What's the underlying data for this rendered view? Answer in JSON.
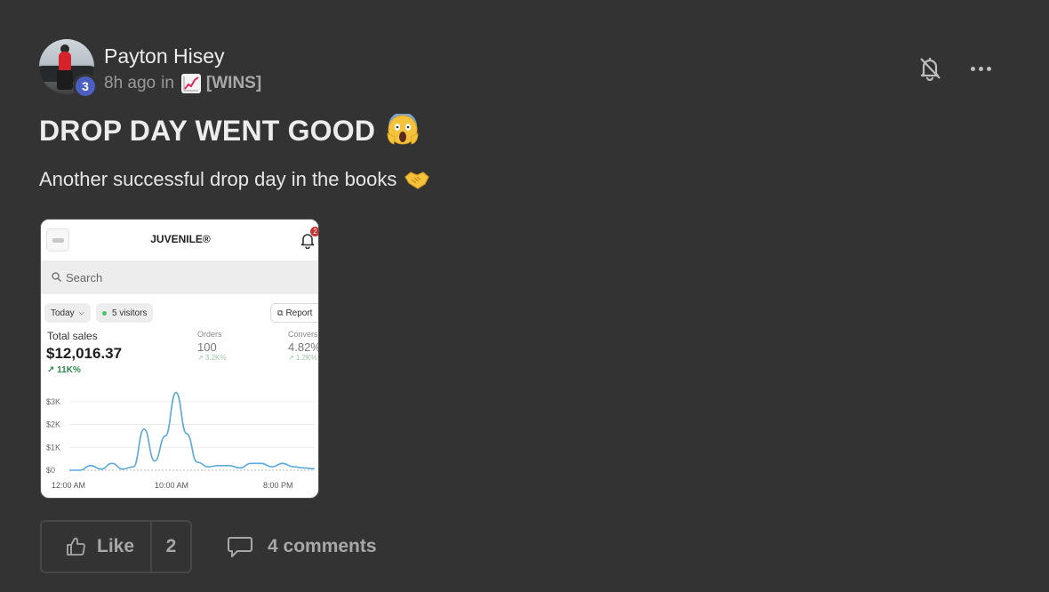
{
  "post": {
    "author": {
      "name": "Payton Hisey",
      "level": "3",
      "avatar_icon": "user-avatar"
    },
    "meta": {
      "time_ago": "8h ago",
      "in_label": "in",
      "category_icon": "chart-increasing-emoji",
      "category": "[WINS]"
    },
    "title": "DROP DAY WENT GOOD",
    "title_emoji": "face-screaming-in-fear-emoji",
    "body": "Another successful drop day in the books",
    "body_emoji": "handshake-emoji",
    "actions": {
      "like_label": "Like",
      "like_count": "2",
      "comments_label": "4 comments",
      "bell_icon": "bell-off-icon",
      "more_icon": "more-horizontal-icon"
    },
    "colors": {
      "background": "#333333",
      "level_badge": "#4a5fc1",
      "muted_text": "#9a9a9a"
    }
  },
  "attachment": {
    "store_name": "JUVENILE®",
    "notification_count": "2",
    "search_placeholder": "Search",
    "filter_today": "Today",
    "visitors": "5 visitors",
    "report_label": "Report",
    "total_sales_label": "Total sales",
    "total_sales_value": "$12,016.37",
    "total_sales_delta": "↗ 11K%",
    "orders_label": "Orders",
    "orders_value": "100",
    "orders_delta": "↗ 3.2K%",
    "conversion_label": "Convers",
    "conversion_value": "4.82%",
    "conversion_delta": "↗ 1.2K%",
    "chart_data": {
      "type": "line",
      "title": "",
      "xlabel": "",
      "ylabel": "",
      "y_ticks": [
        "$3K",
        "$2K",
        "$1K",
        "$0"
      ],
      "x_ticks": [
        "12:00 AM",
        "10:00 AM",
        "8:00 PM"
      ],
      "ylim": [
        0,
        3500
      ],
      "grid": true,
      "x": [
        0,
        1,
        2,
        3,
        4,
        5,
        6,
        7,
        8,
        9,
        10,
        11,
        12,
        13,
        14,
        15,
        16,
        17,
        18,
        19,
        20,
        21,
        22,
        23
      ],
      "series": [
        {
          "values": [
            0,
            0,
            200,
            50,
            300,
            50,
            150,
            1800,
            400,
            1500,
            3400,
            1600,
            350,
            150,
            200,
            200,
            100,
            300,
            300,
            150,
            300,
            150,
            100,
            60
          ]
        }
      ]
    }
  }
}
